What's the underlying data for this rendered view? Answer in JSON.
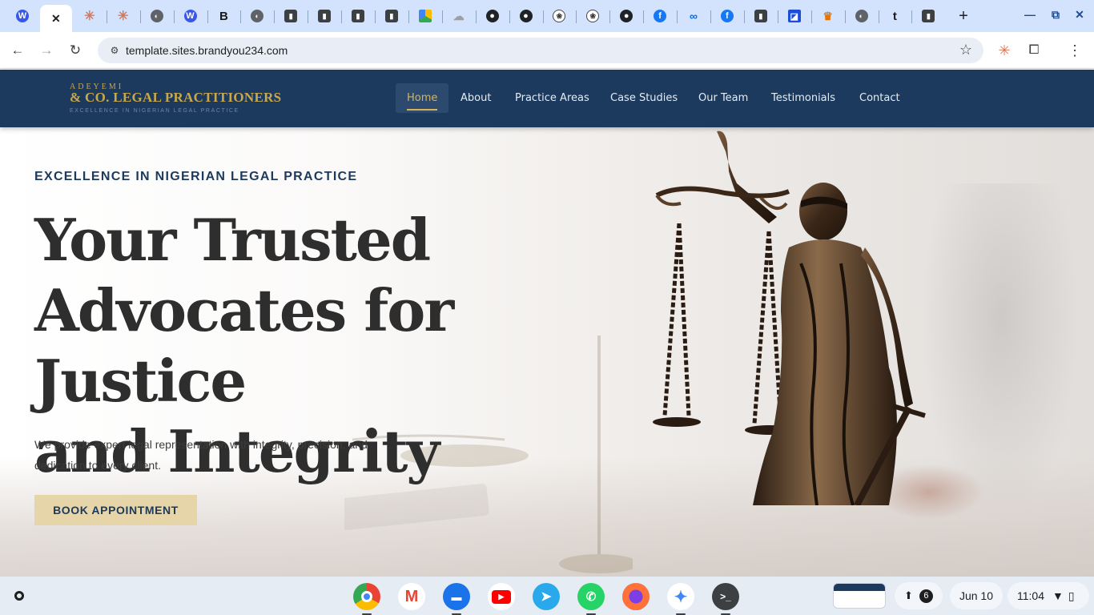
{
  "browser": {
    "tabs": [
      {
        "icon": "wordpress-icon",
        "glyph": "W"
      },
      {
        "icon": "close-tab-icon",
        "glyph": "✕",
        "active": true
      },
      {
        "icon": "claude-icon",
        "glyph": "✳"
      },
      {
        "icon": "claude-icon",
        "glyph": "✳"
      },
      {
        "icon": "globe-icon",
        "glyph": "◐"
      },
      {
        "icon": "wordpress-icon",
        "glyph": "W"
      },
      {
        "icon": "bookmark-b-icon",
        "glyph": "B"
      },
      {
        "icon": "globe-icon",
        "glyph": "◐"
      },
      {
        "icon": "office-building-icon",
        "glyph": "▮"
      },
      {
        "icon": "office-building-icon",
        "glyph": "▮"
      },
      {
        "icon": "office-building-icon",
        "glyph": "▮"
      },
      {
        "icon": "office-building-icon",
        "glyph": "▮"
      },
      {
        "icon": "google-drive-icon",
        "glyph": ""
      },
      {
        "icon": "cloud-icon",
        "glyph": "☁"
      },
      {
        "icon": "github-icon",
        "glyph": "●"
      },
      {
        "icon": "github-icon",
        "glyph": "●"
      },
      {
        "icon": "openai-icon",
        "glyph": "❀"
      },
      {
        "icon": "openai-icon",
        "glyph": "❀"
      },
      {
        "icon": "github-icon",
        "glyph": "●"
      },
      {
        "icon": "facebook-icon",
        "glyph": "f"
      },
      {
        "icon": "meta-icon",
        "glyph": "∞"
      },
      {
        "icon": "facebook-icon",
        "glyph": "f"
      },
      {
        "icon": "office-building-icon",
        "glyph": "▮"
      },
      {
        "icon": "blue-app-icon",
        "glyph": "◪"
      },
      {
        "icon": "crown-icon",
        "glyph": "♛"
      },
      {
        "icon": "globe-icon",
        "glyph": "◐"
      },
      {
        "icon": "tumblr-icon",
        "glyph": "t"
      },
      {
        "icon": "office-building-icon",
        "glyph": "▮"
      }
    ],
    "new_tab_glyph": "+",
    "url": "template.sites.brandyou234.com"
  },
  "site": {
    "logo": {
      "top": "ADEYEMI",
      "main": "& CO. LEGAL PRACTITIONERS",
      "sub": "EXCELLENCE IN NIGERIAN LEGAL PRACTICE"
    },
    "nav": [
      "Home",
      "About",
      "Practice Areas",
      "Case Studies",
      "Our Team",
      "Testimonials",
      "Contact"
    ],
    "active_nav": "Home",
    "hero": {
      "eyebrow": "EXCELLENCE IN NIGERIAN LEGAL PRACTICE",
      "headline_lines": [
        "Your Trusted",
        "Advocates for Justice",
        "and Integrity"
      ],
      "lede": "We provide expert legal representation with integrity, precision, and dedication to every client.",
      "cta": "BOOK APPOINTMENT"
    },
    "colors": {
      "navy": "#1c3a5e",
      "gold": "#c9a84c",
      "cta_bg": "#e6d5a8"
    }
  },
  "shelf": {
    "apps": [
      "chrome-icon",
      "gmail-icon",
      "files-icon",
      "youtube-icon",
      "telegram-icon",
      "whatsapp-icon",
      "firefox-icon",
      "gemini-icon",
      "terminal-icon"
    ],
    "notifications_count": "6",
    "date": "Jun 10",
    "time": "11:04"
  }
}
